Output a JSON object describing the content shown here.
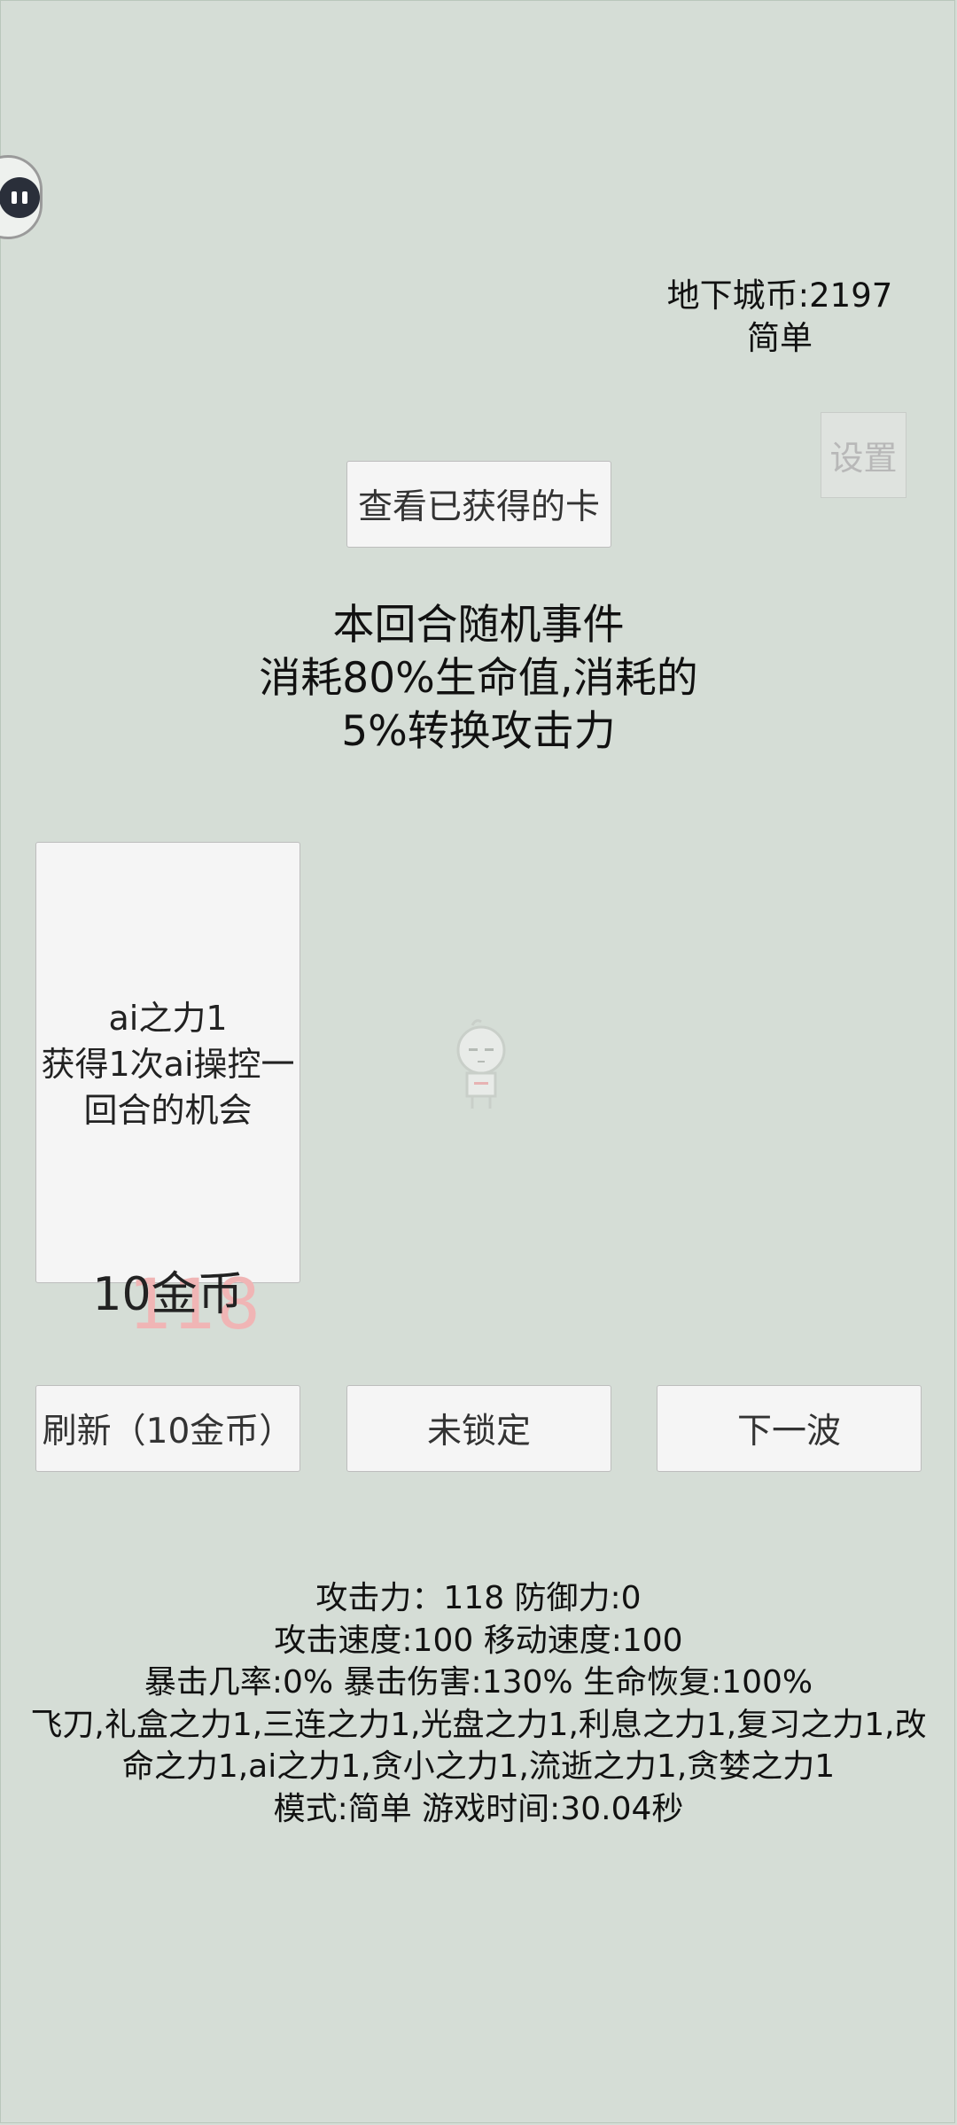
{
  "header": {
    "currency": "地下城币:2197",
    "difficulty": "简单",
    "settings_label": "设置"
  },
  "view_cards_button": "查看已获得的卡",
  "event": {
    "title": "本回合随机事件",
    "line1": "消耗80%生命值,消耗的",
    "line2": "5%转换攻击力"
  },
  "card": {
    "name": "ai之力1",
    "desc_line1": "获得1次ai操控一",
    "desc_line2": "回合的机会",
    "price": "10金币"
  },
  "floating_damage": "118",
  "buttons": {
    "refresh": "刷新（10金币）",
    "lock": "未锁定",
    "next_wave": "下一波"
  },
  "stats": {
    "line1": "攻击力：118 防御力:0",
    "line2": "攻击速度:100 移动速度:100",
    "line3": "暴击几率:0% 暴击伤害:130% 生命恢复:100%",
    "line4": "飞刀,礼盒之力1,三连之力1,光盘之力1,利息之力1,复习之力1,改",
    "line5": "命之力1,ai之力1,贪小之力1,流逝之力1,贪婪之力1",
    "line6": "模式:简单 游戏时间:30.04秒"
  },
  "colors": {
    "background": "#d5ddd6",
    "button": "#f5f5f5",
    "damage_text": "#f0b5b5"
  }
}
